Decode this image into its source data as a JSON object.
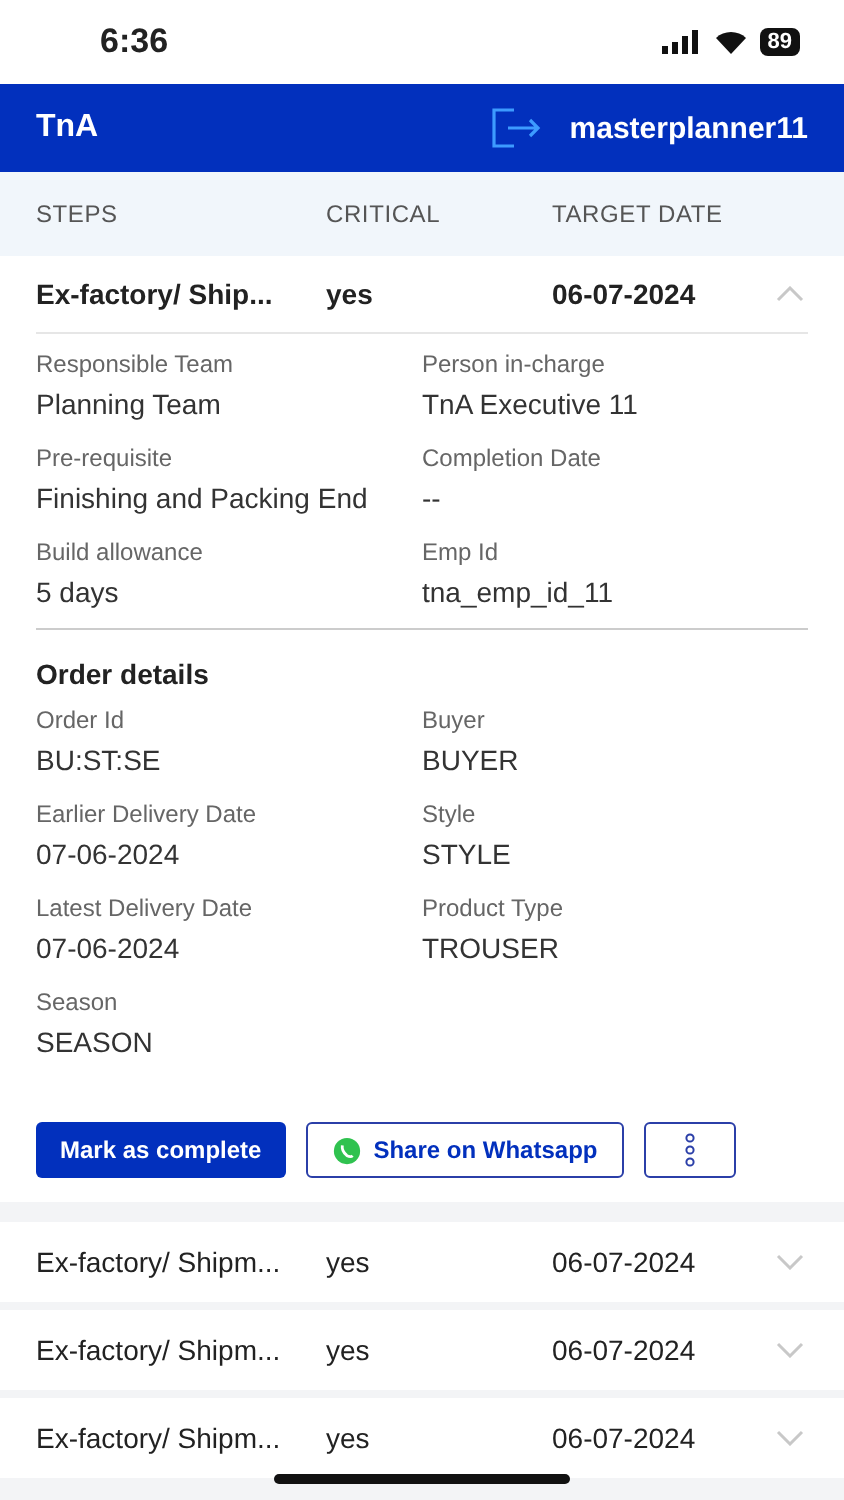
{
  "status_bar": {
    "time": "6:36",
    "battery": "89"
  },
  "header": {
    "title": "TnA",
    "user": "masterplanner11"
  },
  "columns": [
    "STEPS",
    "CRITICAL",
    "TARGET DATE"
  ],
  "rows": [
    {
      "step": "Ex-factory/ Ship...",
      "critical": "yes",
      "target_date": "06-07-2024",
      "expanded": true,
      "fields": [
        {
          "label": "Responsible Team",
          "value": "Planning Team"
        },
        {
          "label": "Person in-charge",
          "value": "TnA Executive 11"
        },
        {
          "label": "Pre-requisite",
          "value": "Finishing and Packing End"
        },
        {
          "label": "Completion Date",
          "value": "--"
        },
        {
          "label": "Build allowance",
          "value": "5 days"
        },
        {
          "label": "Emp Id",
          "value": "tna_emp_id_11"
        }
      ],
      "order_title": "Order details",
      "order_fields": [
        {
          "label": "Order Id",
          "value": "BU:ST:SE"
        },
        {
          "label": "Buyer",
          "value": "BUYER"
        },
        {
          "label": "Earlier Delivery Date",
          "value": "07-06-2024"
        },
        {
          "label": "Style",
          "value": "STYLE"
        },
        {
          "label": "Latest Delivery Date",
          "value": "07-06-2024"
        },
        {
          "label": "Product Type",
          "value": "TROUSER"
        },
        {
          "label": "Season",
          "value": "SEASON"
        }
      ],
      "actions": {
        "complete": "Mark as complete",
        "share": "Share on Whatsapp"
      }
    },
    {
      "step": "Ex-factory/ Shipm...",
      "critical": "yes",
      "target_date": "06-07-2024",
      "expanded": false
    },
    {
      "step": "Ex-factory/ Shipm...",
      "critical": "yes",
      "target_date": "06-07-2024",
      "expanded": false
    },
    {
      "step": "Ex-factory/ Shipm...",
      "critical": "yes",
      "target_date": "06-07-2024",
      "expanded": false
    }
  ]
}
